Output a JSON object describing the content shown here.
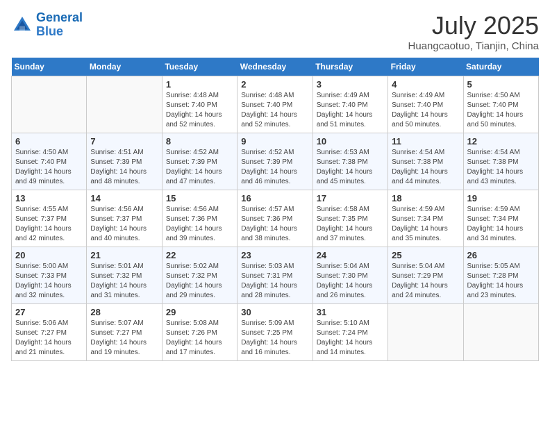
{
  "logo": {
    "line1": "General",
    "line2": "Blue"
  },
  "title": "July 2025",
  "location": "Huangcaotuo, Tianjin, China",
  "days_of_week": [
    "Sunday",
    "Monday",
    "Tuesday",
    "Wednesday",
    "Thursday",
    "Friday",
    "Saturday"
  ],
  "weeks": [
    [
      {
        "day": "",
        "info": ""
      },
      {
        "day": "",
        "info": ""
      },
      {
        "day": "1",
        "info": "Sunrise: 4:48 AM\nSunset: 7:40 PM\nDaylight: 14 hours and 52 minutes."
      },
      {
        "day": "2",
        "info": "Sunrise: 4:48 AM\nSunset: 7:40 PM\nDaylight: 14 hours and 52 minutes."
      },
      {
        "day": "3",
        "info": "Sunrise: 4:49 AM\nSunset: 7:40 PM\nDaylight: 14 hours and 51 minutes."
      },
      {
        "day": "4",
        "info": "Sunrise: 4:49 AM\nSunset: 7:40 PM\nDaylight: 14 hours and 50 minutes."
      },
      {
        "day": "5",
        "info": "Sunrise: 4:50 AM\nSunset: 7:40 PM\nDaylight: 14 hours and 50 minutes."
      }
    ],
    [
      {
        "day": "6",
        "info": "Sunrise: 4:50 AM\nSunset: 7:40 PM\nDaylight: 14 hours and 49 minutes."
      },
      {
        "day": "7",
        "info": "Sunrise: 4:51 AM\nSunset: 7:39 PM\nDaylight: 14 hours and 48 minutes."
      },
      {
        "day": "8",
        "info": "Sunrise: 4:52 AM\nSunset: 7:39 PM\nDaylight: 14 hours and 47 minutes."
      },
      {
        "day": "9",
        "info": "Sunrise: 4:52 AM\nSunset: 7:39 PM\nDaylight: 14 hours and 46 minutes."
      },
      {
        "day": "10",
        "info": "Sunrise: 4:53 AM\nSunset: 7:38 PM\nDaylight: 14 hours and 45 minutes."
      },
      {
        "day": "11",
        "info": "Sunrise: 4:54 AM\nSunset: 7:38 PM\nDaylight: 14 hours and 44 minutes."
      },
      {
        "day": "12",
        "info": "Sunrise: 4:54 AM\nSunset: 7:38 PM\nDaylight: 14 hours and 43 minutes."
      }
    ],
    [
      {
        "day": "13",
        "info": "Sunrise: 4:55 AM\nSunset: 7:37 PM\nDaylight: 14 hours and 42 minutes."
      },
      {
        "day": "14",
        "info": "Sunrise: 4:56 AM\nSunset: 7:37 PM\nDaylight: 14 hours and 40 minutes."
      },
      {
        "day": "15",
        "info": "Sunrise: 4:56 AM\nSunset: 7:36 PM\nDaylight: 14 hours and 39 minutes."
      },
      {
        "day": "16",
        "info": "Sunrise: 4:57 AM\nSunset: 7:36 PM\nDaylight: 14 hours and 38 minutes."
      },
      {
        "day": "17",
        "info": "Sunrise: 4:58 AM\nSunset: 7:35 PM\nDaylight: 14 hours and 37 minutes."
      },
      {
        "day": "18",
        "info": "Sunrise: 4:59 AM\nSunset: 7:34 PM\nDaylight: 14 hours and 35 minutes."
      },
      {
        "day": "19",
        "info": "Sunrise: 4:59 AM\nSunset: 7:34 PM\nDaylight: 14 hours and 34 minutes."
      }
    ],
    [
      {
        "day": "20",
        "info": "Sunrise: 5:00 AM\nSunset: 7:33 PM\nDaylight: 14 hours and 32 minutes."
      },
      {
        "day": "21",
        "info": "Sunrise: 5:01 AM\nSunset: 7:32 PM\nDaylight: 14 hours and 31 minutes."
      },
      {
        "day": "22",
        "info": "Sunrise: 5:02 AM\nSunset: 7:32 PM\nDaylight: 14 hours and 29 minutes."
      },
      {
        "day": "23",
        "info": "Sunrise: 5:03 AM\nSunset: 7:31 PM\nDaylight: 14 hours and 28 minutes."
      },
      {
        "day": "24",
        "info": "Sunrise: 5:04 AM\nSunset: 7:30 PM\nDaylight: 14 hours and 26 minutes."
      },
      {
        "day": "25",
        "info": "Sunrise: 5:04 AM\nSunset: 7:29 PM\nDaylight: 14 hours and 24 minutes."
      },
      {
        "day": "26",
        "info": "Sunrise: 5:05 AM\nSunset: 7:28 PM\nDaylight: 14 hours and 23 minutes."
      }
    ],
    [
      {
        "day": "27",
        "info": "Sunrise: 5:06 AM\nSunset: 7:27 PM\nDaylight: 14 hours and 21 minutes."
      },
      {
        "day": "28",
        "info": "Sunrise: 5:07 AM\nSunset: 7:27 PM\nDaylight: 14 hours and 19 minutes."
      },
      {
        "day": "29",
        "info": "Sunrise: 5:08 AM\nSunset: 7:26 PM\nDaylight: 14 hours and 17 minutes."
      },
      {
        "day": "30",
        "info": "Sunrise: 5:09 AM\nSunset: 7:25 PM\nDaylight: 14 hours and 16 minutes."
      },
      {
        "day": "31",
        "info": "Sunrise: 5:10 AM\nSunset: 7:24 PM\nDaylight: 14 hours and 14 minutes."
      },
      {
        "day": "",
        "info": ""
      },
      {
        "day": "",
        "info": ""
      }
    ]
  ]
}
